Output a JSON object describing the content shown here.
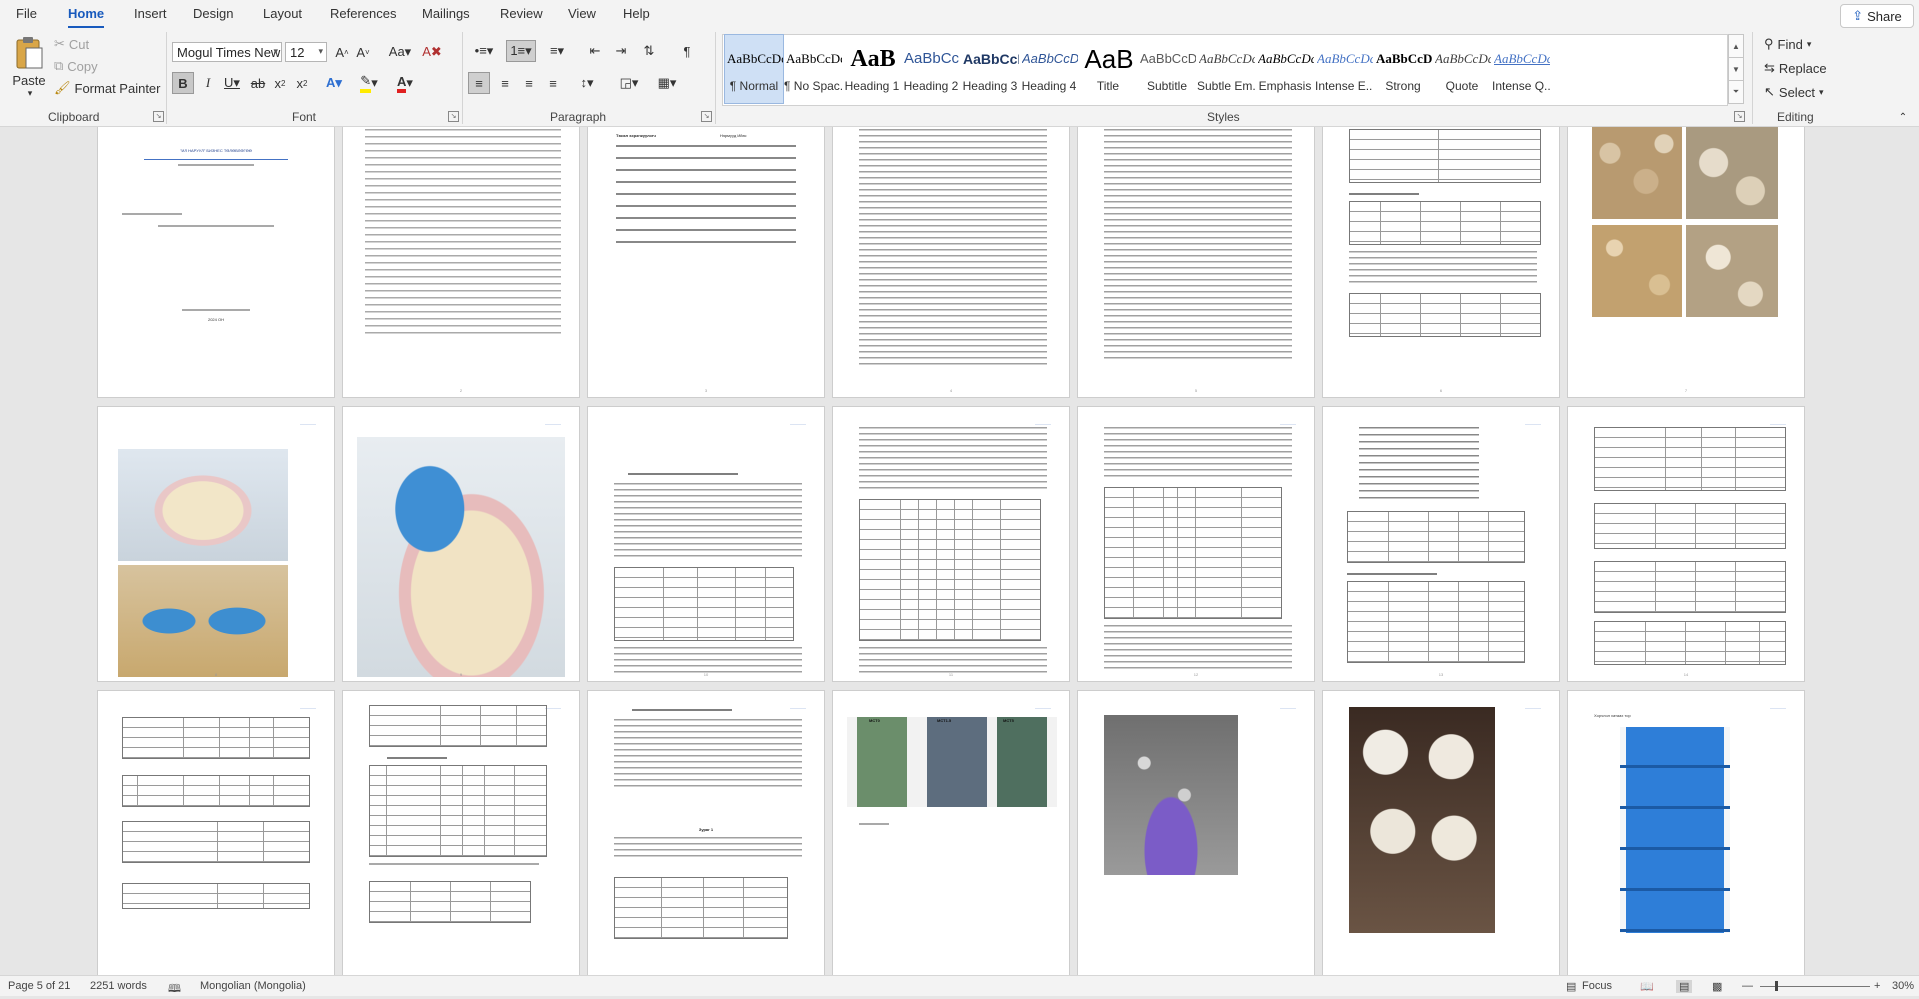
{
  "tabs": {
    "file": "File",
    "home": "Home",
    "insert": "Insert",
    "design": "Design",
    "layout": "Layout",
    "references": "References",
    "mailings": "Mailings",
    "review": "Review",
    "view": "View",
    "help": "Help",
    "share": "Share"
  },
  "ribbon": {
    "clipboard": {
      "paste": "Paste",
      "cut": "Cut",
      "copy": "Copy",
      "format_painter": "Format Painter",
      "label": "Clipboard"
    },
    "font": {
      "font_name": "Mogul Times New",
      "font_size": "12",
      "label": "Font"
    },
    "paragraph": {
      "label": "Paragraph"
    },
    "styles": {
      "label": "Styles",
      "items": [
        {
          "preview": "AaBbCcDc",
          "name": "¶ Normal"
        },
        {
          "preview": "AaBbCcDc",
          "name": "¶ No Spac..."
        },
        {
          "preview": "AaB",
          "name": "Heading 1"
        },
        {
          "preview": "AaBbCcI",
          "name": "Heading 2"
        },
        {
          "preview": "AaBbCcI",
          "name": "Heading 3"
        },
        {
          "preview": "AaBbCcD",
          "name": "Heading 4"
        },
        {
          "preview": "AaB",
          "name": "Title"
        },
        {
          "preview": "AaBbCcD",
          "name": "Subtitle"
        },
        {
          "preview": "AaBbCcDc",
          "name": "Subtle Em..."
        },
        {
          "preview": "AaBbCcDc",
          "name": "Emphasis"
        },
        {
          "preview": "AaBbCcDc",
          "name": "Intense E..."
        },
        {
          "preview": "AaBbCcDc",
          "name": "Strong"
        },
        {
          "preview": "AaBbCcDc",
          "name": "Quote"
        },
        {
          "preview": "AaBbCcDc",
          "name": "Intense Q..."
        }
      ]
    },
    "editing": {
      "find": "Find",
      "replace": "Replace",
      "select": "Select",
      "label": "Editing"
    }
  },
  "status": {
    "page": "Page 5 of 21",
    "words": "2251 words",
    "language": "Mongolian (Mongolia)",
    "focus": "Focus",
    "zoom": "30%"
  },
  "doc": {
    "p1_title": "\"ИЛ НАРУУЛ\" БИЗНЕС ТӨЛӨВЛӨГӨӨ",
    "p1_year": "2024 ОН",
    "p3_label_1": "Төсөл хэрэгжүүлэгч",
    "p3_value_1": "Нэрмүүд Ийэс",
    "p10_caption_1": "Зураг 1",
    "p17_caption": "МСТ5",
    "p17_caption_b": "МСТ1.5",
    "p17_caption_c": "МСТ0",
    "p20_caption": "Хорчлол хатаах тор"
  }
}
